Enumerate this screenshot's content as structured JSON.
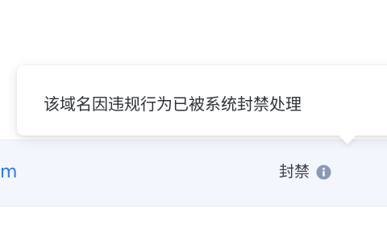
{
  "row": {
    "domain_fragment": "m",
    "status_label": "封禁"
  },
  "tooltip": {
    "text": "该域名因违规行为已被系统封禁处理"
  },
  "icons": {
    "status_info": "info-icon"
  },
  "colors": {
    "row_background": "#f3f6fc",
    "domain_link": "#2c7be5",
    "info_icon": "#8a9ab3"
  }
}
